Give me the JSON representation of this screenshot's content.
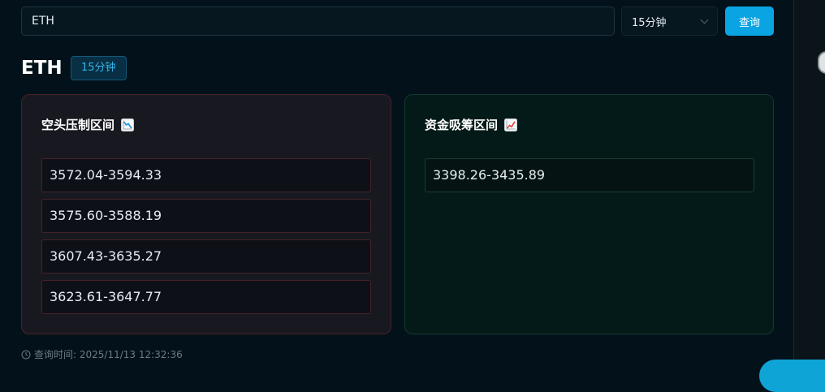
{
  "search": {
    "value": "ETH",
    "interval_selected": "15分钟",
    "query_button_label": "查询"
  },
  "header": {
    "symbol": "ETH",
    "interval_tag": "15分钟"
  },
  "short_panel": {
    "title": "空头压制区间",
    "icon": "chart-decreasing-icon",
    "accent_color": "#4a2127",
    "ranges": [
      "3572.04-3594.33",
      "3575.60-3588.19",
      "3607.43-3635.27",
      "3623.61-3647.77"
    ]
  },
  "long_panel": {
    "title": "资金吸筹区间",
    "icon": "chart-increasing-icon",
    "accent_color": "#113a2e",
    "ranges": [
      "3398.26-3435.89"
    ]
  },
  "footer": {
    "query_time": "查询时间: 2025/11/13 12:32:36"
  },
  "colors": {
    "background": "#03121a",
    "primary_button": "#0ba4e3",
    "tag_text": "#36b3ea"
  }
}
